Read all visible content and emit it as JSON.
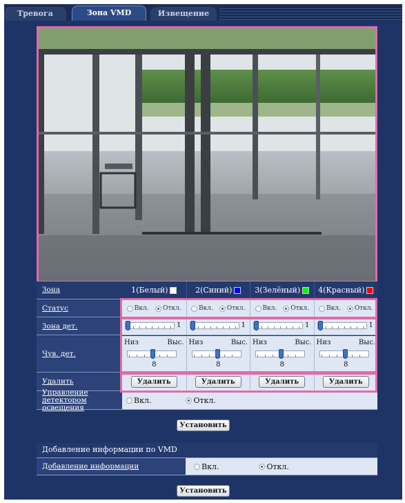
{
  "tabs": [
    {
      "label": "Тревога",
      "active": false
    },
    {
      "label": "Зона VMD",
      "active": true
    },
    {
      "label": "Извещение",
      "active": false
    }
  ],
  "image": {
    "description_icon": "camera-live-image"
  },
  "table": {
    "zone_label": "Зона",
    "zones": [
      {
        "label": "1(Белый)",
        "color": "#ffffff"
      },
      {
        "label": "2(Синий)",
        "color": "#0000ff"
      },
      {
        "label": "3(Зелёный)",
        "color": "#00ff00"
      },
      {
        "label": "4(Красный)",
        "color": "#ff0000"
      }
    ],
    "status_label": "Статус",
    "status_on": "Вкл.",
    "status_off": "Откл.",
    "status_values": [
      "off",
      "off",
      "off",
      "off"
    ],
    "detect_zone_label": "Зона дет.",
    "detect_zone_values": [
      "1",
      "1",
      "1",
      "1"
    ],
    "sensitivity_label": "Чув. дет.",
    "sens_low": "Низ",
    "sens_high": "Выс.",
    "sensitivity_values": [
      "8",
      "8",
      "8",
      "8"
    ],
    "delete_label": "Удалить",
    "delete_button": "Удалить",
    "light_label": "Управление детектором освещения",
    "light_on": "Вкл.",
    "light_off": "Откл.",
    "light_value": "off"
  },
  "set_button_1": "Установить",
  "vmd_info": {
    "section_title": "Добавление информации по VMD",
    "add_info_label": "Добавление информации",
    "on": "Вкл.",
    "off": "Откл.",
    "value": "off"
  },
  "set_button_2": "Установить",
  "colors": {
    "accent": "#e26aa9",
    "panel": "#1f3466"
  }
}
